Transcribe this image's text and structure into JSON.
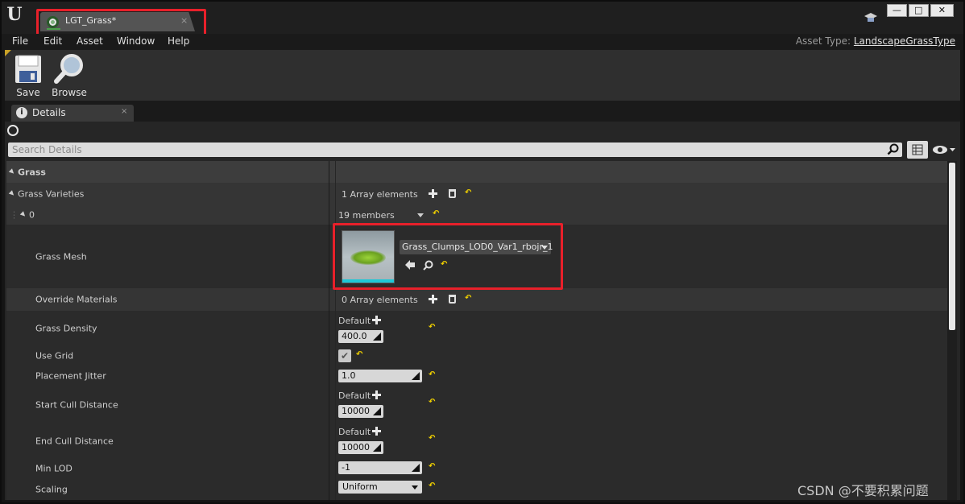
{
  "titlebar": {
    "tab_label": "LGT_Grass*",
    "tab_close": "×",
    "window_buttons": [
      "—",
      "□",
      "✕"
    ]
  },
  "menu": {
    "items": [
      "File",
      "Edit",
      "Asset",
      "Window",
      "Help"
    ],
    "asset_type_label": "Asset Type:",
    "asset_type_value": "LandscapeGrassType"
  },
  "toolbar": {
    "save_label": "Save",
    "browse_label": "Browse"
  },
  "details": {
    "tab_label": "Details",
    "tab_close": "×",
    "search_placeholder": "Search Details"
  },
  "properties": {
    "category": "Grass",
    "grass_varieties": {
      "label": "Grass Varieties",
      "value": "1 Array elements"
    },
    "element0": {
      "label": "0",
      "value": "19 members"
    },
    "grass_mesh": {
      "label": "Grass Mesh",
      "value": "Grass_Clumps_LOD0_Var1_rbojr_1"
    },
    "override_materials": {
      "label": "Override Materials",
      "value": "0 Array elements"
    },
    "grass_density": {
      "label": "Grass Density",
      "default_label": "Default",
      "value": "400.0"
    },
    "use_grid": {
      "label": "Use Grid",
      "checked": true,
      "check_glyph": "✔"
    },
    "placement_jitter": {
      "label": "Placement Jitter",
      "value": "1.0"
    },
    "start_cull_distance": {
      "label": "Start Cull Distance",
      "default_label": "Default",
      "value": "10000"
    },
    "end_cull_distance": {
      "label": "End Cull Distance",
      "default_label": "Default",
      "value": "10000"
    },
    "min_lod": {
      "label": "Min LOD",
      "value": "-1"
    },
    "scaling": {
      "label": "Scaling",
      "value": "Uniform"
    }
  },
  "watermark": "CSDN @不要积累问题",
  "colors": {
    "highlight": "#e8202a",
    "reset_arrow": "#f0d000",
    "thumb_bar": "#1ec8d8"
  }
}
